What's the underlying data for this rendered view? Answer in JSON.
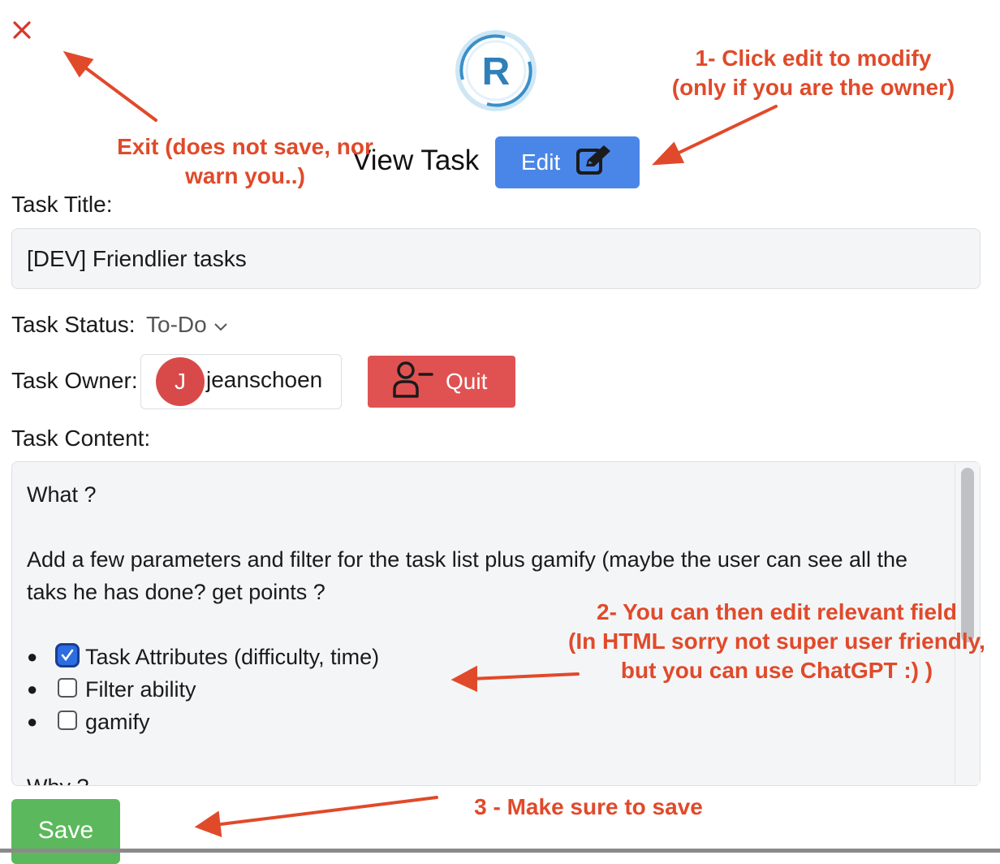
{
  "header": {
    "close_icon": "close-icon",
    "logo_letter": "R",
    "title": "View Task",
    "edit_label": "Edit"
  },
  "form": {
    "title_label": "Task Title:",
    "title_value": "[DEV] Friendlier tasks",
    "status_label": "Task Status:",
    "status_value": "To-Do",
    "owner_label": "Task Owner:",
    "owner_initial": "J",
    "owner_name": "jeanschoen",
    "quit_label": "Quit",
    "content_label": "Task Content:"
  },
  "content": {
    "heading_what": "What ?",
    "paragraph": "Add a few parameters and filter for the task list plus gamify (maybe the user can see all the taks he has done? get points ?",
    "todos": [
      {
        "label": "Task Attributes (difficulty, time)",
        "checked": true
      },
      {
        "label": "Filter ability",
        "checked": false
      },
      {
        "label": "gamify",
        "checked": false
      }
    ],
    "heading_why": "Why ?"
  },
  "footer": {
    "save_label": "Save"
  },
  "annotations": {
    "exit_line1": "Exit (does not save, nor",
    "exit_line2": "warn you..)",
    "edit_line1": "1- Click edit to modify",
    "edit_line2": "(only if you are the owner)",
    "field_line1": "2- You can then edit relevant field",
    "field_line2": "(In HTML sorry not super user friendly,",
    "field_line3": "but you can use ChatGPT :) )",
    "save_note": "3 - Make sure to save"
  },
  "colors": {
    "annotation_red": "#e04a2a",
    "edit_blue": "#4a86e8",
    "quit_red": "#e05252",
    "save_green": "#5cb85c"
  }
}
